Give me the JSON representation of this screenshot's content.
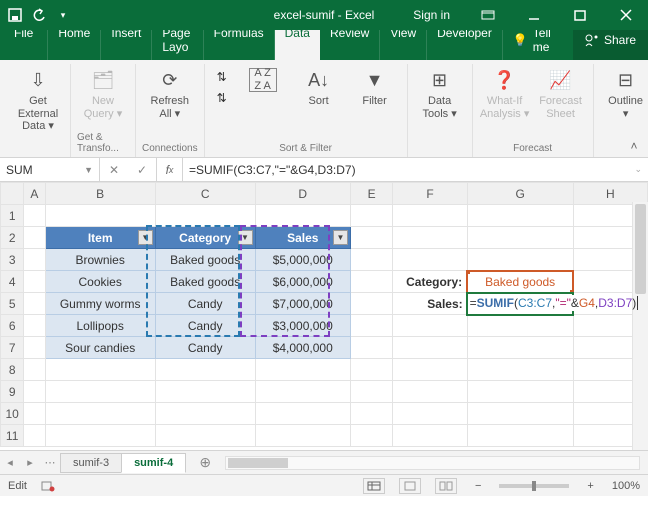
{
  "titlebar": {
    "doc": "excel-sumif - Excel",
    "signin": "Sign in"
  },
  "menu": {
    "items": [
      "File",
      "Home",
      "Insert",
      "Page Layo",
      "Formulas",
      "Data",
      "Review",
      "View",
      "Developer"
    ],
    "active": 5,
    "tellme": "Tell me",
    "share": "Share"
  },
  "ribbon": {
    "groups": [
      {
        "label": "",
        "buttons": [
          {
            "t": "Get External\nData ▾"
          }
        ]
      },
      {
        "label": "Get & Transfo...",
        "buttons": [
          {
            "t": "New\nQuery ▾",
            "dis": true
          }
        ]
      },
      {
        "label": "Connections",
        "buttons": [
          {
            "t": "Refresh\nAll ▾"
          }
        ]
      },
      {
        "label": "Sort & Filter",
        "buttons": [
          {
            "t": "Sort"
          },
          {
            "t": "Filter"
          }
        ]
      },
      {
        "label": "",
        "buttons": [
          {
            "t": "Data\nTools ▾"
          }
        ]
      },
      {
        "label": "Forecast",
        "buttons": [
          {
            "t": "What-If\nAnalysis ▾",
            "dis": true
          },
          {
            "t": "Forecast\nSheet",
            "dis": true
          }
        ]
      },
      {
        "label": "",
        "buttons": [
          {
            "t": "Outline\n▾"
          }
        ]
      }
    ]
  },
  "namebox": "SUM",
  "formula_bar": "=SUMIF(C3:C7,\"=\"&G4,D3:D7)",
  "columns": [
    "A",
    "B",
    "C",
    "D",
    "E",
    "F",
    "G",
    "H"
  ],
  "rows": [
    "1",
    "2",
    "3",
    "4",
    "5",
    "6",
    "7",
    "8",
    "9",
    "10",
    "11"
  ],
  "table": {
    "headers": [
      "Item",
      "Category",
      "Sales"
    ],
    "data": [
      [
        "Brownies",
        "Baked goods",
        "$5,000,000"
      ],
      [
        "Cookies",
        "Baked goods",
        "$6,000,000"
      ],
      [
        "Gummy worms",
        "Candy",
        "$7,000,000"
      ],
      [
        "Lollipops",
        "Candy",
        "$3,000,000"
      ],
      [
        "Sour candies",
        "Candy",
        "$4,000,000"
      ]
    ]
  },
  "side": {
    "cat_label": "Category:",
    "cat_value": "Baked goods",
    "sales_label": "Sales:",
    "formula_parts": {
      "eq": "=",
      "fn": "SUMIF",
      "p": "(",
      "r1": "C3:C7",
      "c1": ",",
      "str": "\"=\"",
      "amp": "&",
      "r2": "G4",
      "c2": ",",
      "r3": "D3:D7",
      "p2": ")"
    }
  },
  "tabs": {
    "list": [
      "sumif-3",
      "sumif-4"
    ],
    "active": 1
  },
  "status": {
    "mode": "Edit",
    "zoom": "100%"
  }
}
